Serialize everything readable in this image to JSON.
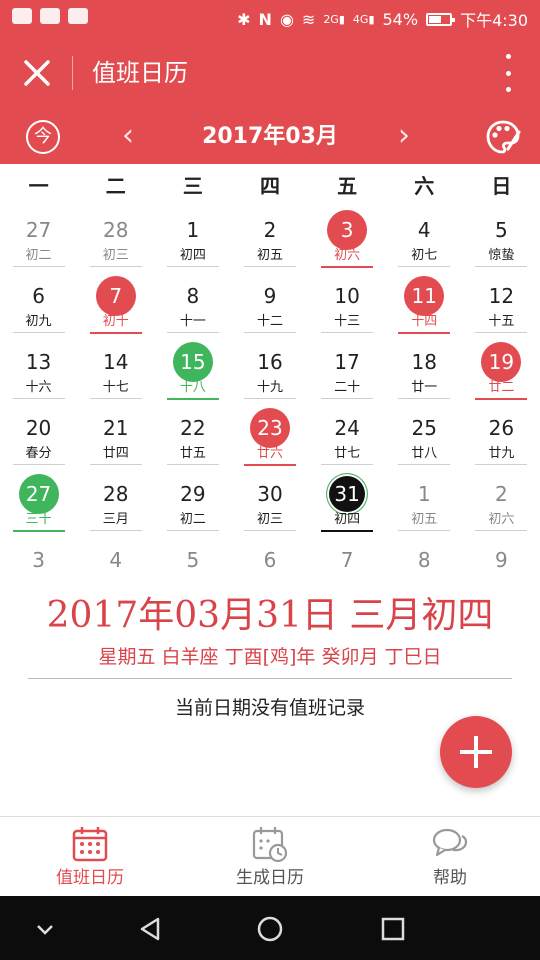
{
  "status_bar": {
    "battery": "54%",
    "time": "下午4:30",
    "net1": "2G",
    "net2": "4G"
  },
  "app_bar": {
    "title": "值班日历"
  },
  "month_nav": {
    "today_glyph": "今",
    "prev": "‹",
    "next": "›",
    "month": "2017年03月"
  },
  "weekdays": [
    "一",
    "二",
    "三",
    "四",
    "五",
    "六",
    "日"
  ],
  "calendar": {
    "weeks": [
      [
        {
          "d": "27",
          "l": "初二",
          "s": "muted"
        },
        {
          "d": "28",
          "l": "初三",
          "s": "muted"
        },
        {
          "d": "1",
          "l": "初四",
          "s": ""
        },
        {
          "d": "2",
          "l": "初五",
          "s": ""
        },
        {
          "d": "3",
          "l": "初六",
          "s": "red"
        },
        {
          "d": "4",
          "l": "初七",
          "s": ""
        },
        {
          "d": "5",
          "l": "惊蛰",
          "s": ""
        }
      ],
      [
        {
          "d": "6",
          "l": "初九",
          "s": ""
        },
        {
          "d": "7",
          "l": "初十",
          "s": "red"
        },
        {
          "d": "8",
          "l": "十一",
          "s": ""
        },
        {
          "d": "9",
          "l": "十二",
          "s": ""
        },
        {
          "d": "10",
          "l": "十三",
          "s": ""
        },
        {
          "d": "11",
          "l": "十四",
          "s": "red"
        },
        {
          "d": "12",
          "l": "十五",
          "s": ""
        }
      ],
      [
        {
          "d": "13",
          "l": "十六",
          "s": ""
        },
        {
          "d": "14",
          "l": "十七",
          "s": ""
        },
        {
          "d": "15",
          "l": "十八",
          "s": "green"
        },
        {
          "d": "16",
          "l": "十九",
          "s": ""
        },
        {
          "d": "17",
          "l": "二十",
          "s": ""
        },
        {
          "d": "18",
          "l": "廿一",
          "s": ""
        },
        {
          "d": "19",
          "l": "廿二",
          "s": "red"
        }
      ],
      [
        {
          "d": "20",
          "l": "春分",
          "s": ""
        },
        {
          "d": "21",
          "l": "廿四",
          "s": ""
        },
        {
          "d": "22",
          "l": "廿五",
          "s": ""
        },
        {
          "d": "23",
          "l": "廿六",
          "s": "red"
        },
        {
          "d": "24",
          "l": "廿七",
          "s": ""
        },
        {
          "d": "25",
          "l": "廿八",
          "s": ""
        },
        {
          "d": "26",
          "l": "廿九",
          "s": ""
        }
      ],
      [
        {
          "d": "27",
          "l": "三十",
          "s": "green"
        },
        {
          "d": "28",
          "l": "三月",
          "s": ""
        },
        {
          "d": "29",
          "l": "初二",
          "s": ""
        },
        {
          "d": "30",
          "l": "初三",
          "s": ""
        },
        {
          "d": "31",
          "l": "初四",
          "s": "selected"
        },
        {
          "d": "1",
          "l": "初五",
          "s": "muted"
        },
        {
          "d": "2",
          "l": "初六",
          "s": "muted"
        }
      ],
      [
        {
          "d": "3",
          "l": "",
          "s": "muted"
        },
        {
          "d": "4",
          "l": "",
          "s": "muted"
        },
        {
          "d": "5",
          "l": "",
          "s": "muted"
        },
        {
          "d": "6",
          "l": "",
          "s": "muted"
        },
        {
          "d": "7",
          "l": "",
          "s": "muted"
        },
        {
          "d": "8",
          "l": "",
          "s": "muted"
        },
        {
          "d": "9",
          "l": "",
          "s": "muted"
        }
      ]
    ]
  },
  "selected": {
    "big": "2017年03月31日 三月初四",
    "sub": "星期五 白羊座 丁酉[鸡]年 癸卯月 丁巳日",
    "note": "当前日期没有值班记录"
  },
  "tabs": [
    {
      "label": "值班日历",
      "icon": "calendar-icon",
      "active": true
    },
    {
      "label": "生成日历",
      "icon": "calendar-clock-icon",
      "active": false
    },
    {
      "label": "帮助",
      "icon": "chat-bubbles-icon",
      "active": false
    }
  ],
  "colors": {
    "primary": "#e24b4f",
    "green": "#3fb55c",
    "selected": "#111111"
  }
}
